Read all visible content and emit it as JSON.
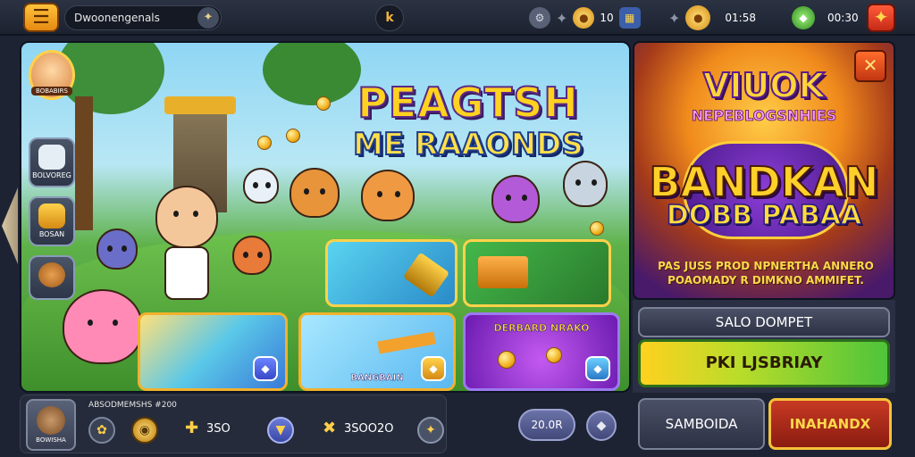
{
  "topbar": {
    "title": "Dwoonengenals",
    "level_label": "k",
    "resource1_value": "10",
    "resource2_value": "01:58",
    "resource3_value": "00:30"
  },
  "game": {
    "headline_line1": "PEAGTSH",
    "headline_line2": "ME RAAONDS",
    "avatar_label": "BOBABIRS",
    "side_slot1_label": "BOLVOREG",
    "side_slot2_label": "BOSAN",
    "card_green_label": "BANGBAIN",
    "card_purple_title": "DERBARD NRAKO"
  },
  "promo": {
    "title1": "VIUOK",
    "title2": "NEPEBLOGSNHIES",
    "title3": "BANDKAN",
    "title4": "DOBB PABAA",
    "subtext_line1": "PAS JUSS PROD NPNERTHA ANNERO",
    "subtext_line2": "POAOMADY R DIMKNO AMMIFET.",
    "btn_top": "SALO DOMPET",
    "btn_main": "PKI LJSBRIAY",
    "btn_left": "SAMBOIDA",
    "btn_right": "INAHANDX"
  },
  "bottombar": {
    "title": "ABSODMEMSHS #200",
    "avatar_label": "BOWISHA",
    "stat1": "3SO",
    "stat2": "3SOO2O",
    "timer": "20.0R"
  },
  "colors": {
    "accent_gold": "#ffd21f",
    "brand_purple": "#5a2a86",
    "green_button": "#4ec43a",
    "red_button": "#c83a24"
  }
}
